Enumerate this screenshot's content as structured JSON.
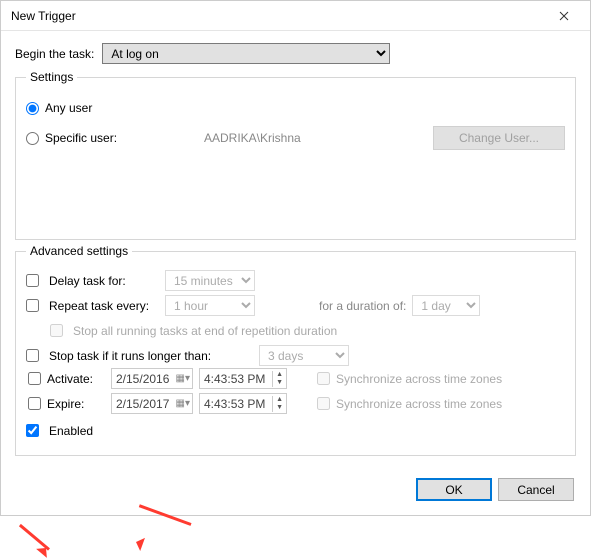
{
  "window": {
    "title": "New Trigger"
  },
  "begin": {
    "label": "Begin the task:",
    "value": "At log on"
  },
  "settings": {
    "legend": "Settings",
    "any_user": {
      "label": "Any user",
      "checked": true
    },
    "specific_user": {
      "label": "Specific user:",
      "checked": false,
      "value": "AADRIKA\\Krishna"
    },
    "change_user": "Change User..."
  },
  "advanced": {
    "legend": "Advanced settings",
    "delay": {
      "label": "Delay task for:",
      "value": "15 minutes",
      "checked": false
    },
    "repeat": {
      "label": "Repeat task every:",
      "value": "1 hour",
      "checked": false,
      "duration_label": "for a duration of:",
      "duration_value": "1 day"
    },
    "stop_all": {
      "label": "Stop all running tasks at end of repetition duration",
      "checked": false
    },
    "stop_long": {
      "label": "Stop task if it runs longer than:",
      "value": "3 days",
      "checked": false
    },
    "activate": {
      "label": "Activate:",
      "checked": false,
      "date": "2/15/2016",
      "time": "4:43:53 PM",
      "sync_label": "Synchronize across time zones",
      "sync": false
    },
    "expire": {
      "label": "Expire:",
      "checked": false,
      "date": "2/15/2017",
      "time": "4:43:53 PM",
      "sync_label": "Synchronize across time zones",
      "sync": false
    },
    "enabled": {
      "label": "Enabled",
      "checked": true
    }
  },
  "buttons": {
    "ok": "OK",
    "cancel": "Cancel"
  }
}
